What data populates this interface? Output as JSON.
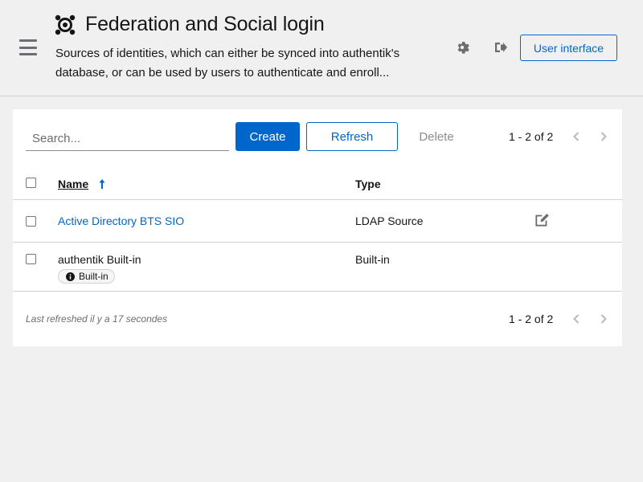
{
  "header": {
    "title": "Federation and Social login",
    "description_line1": "Sources of identities, which can either be synced into authentik's",
    "description_line2": "database, or can be used by users to authenticate and enroll...",
    "user_interface_label": "User interface",
    "title_icon": "federation-icon",
    "settings_icon": "gear-icon",
    "logout_icon": "sign-out-icon",
    "menu_icon": "hamburger-icon"
  },
  "toolbar": {
    "search_placeholder": "Search...",
    "search_value": "",
    "create_label": "Create",
    "refresh_label": "Refresh",
    "delete_label": "Delete"
  },
  "pagination": {
    "range_top": "1 - 2 of 2",
    "range_bottom": "1 - 2 of 2"
  },
  "table": {
    "columns": [
      "Name",
      "Type"
    ],
    "sort_direction": "ascending",
    "rows": [
      {
        "name": "Active Directory BTS SIO",
        "type": "LDAP Source",
        "is_link": true,
        "editable": true
      },
      {
        "name": "authentik Built-in",
        "type": "Built-in",
        "badge": "Built-in",
        "is_link": false,
        "editable": false
      }
    ]
  },
  "footer": {
    "last_refreshed": "Last refreshed il y a 17 secondes"
  },
  "colors": {
    "accent": "#0066cc",
    "background": "#f0f0f0",
    "card": "#ffffff",
    "muted": "#6a6e73"
  }
}
